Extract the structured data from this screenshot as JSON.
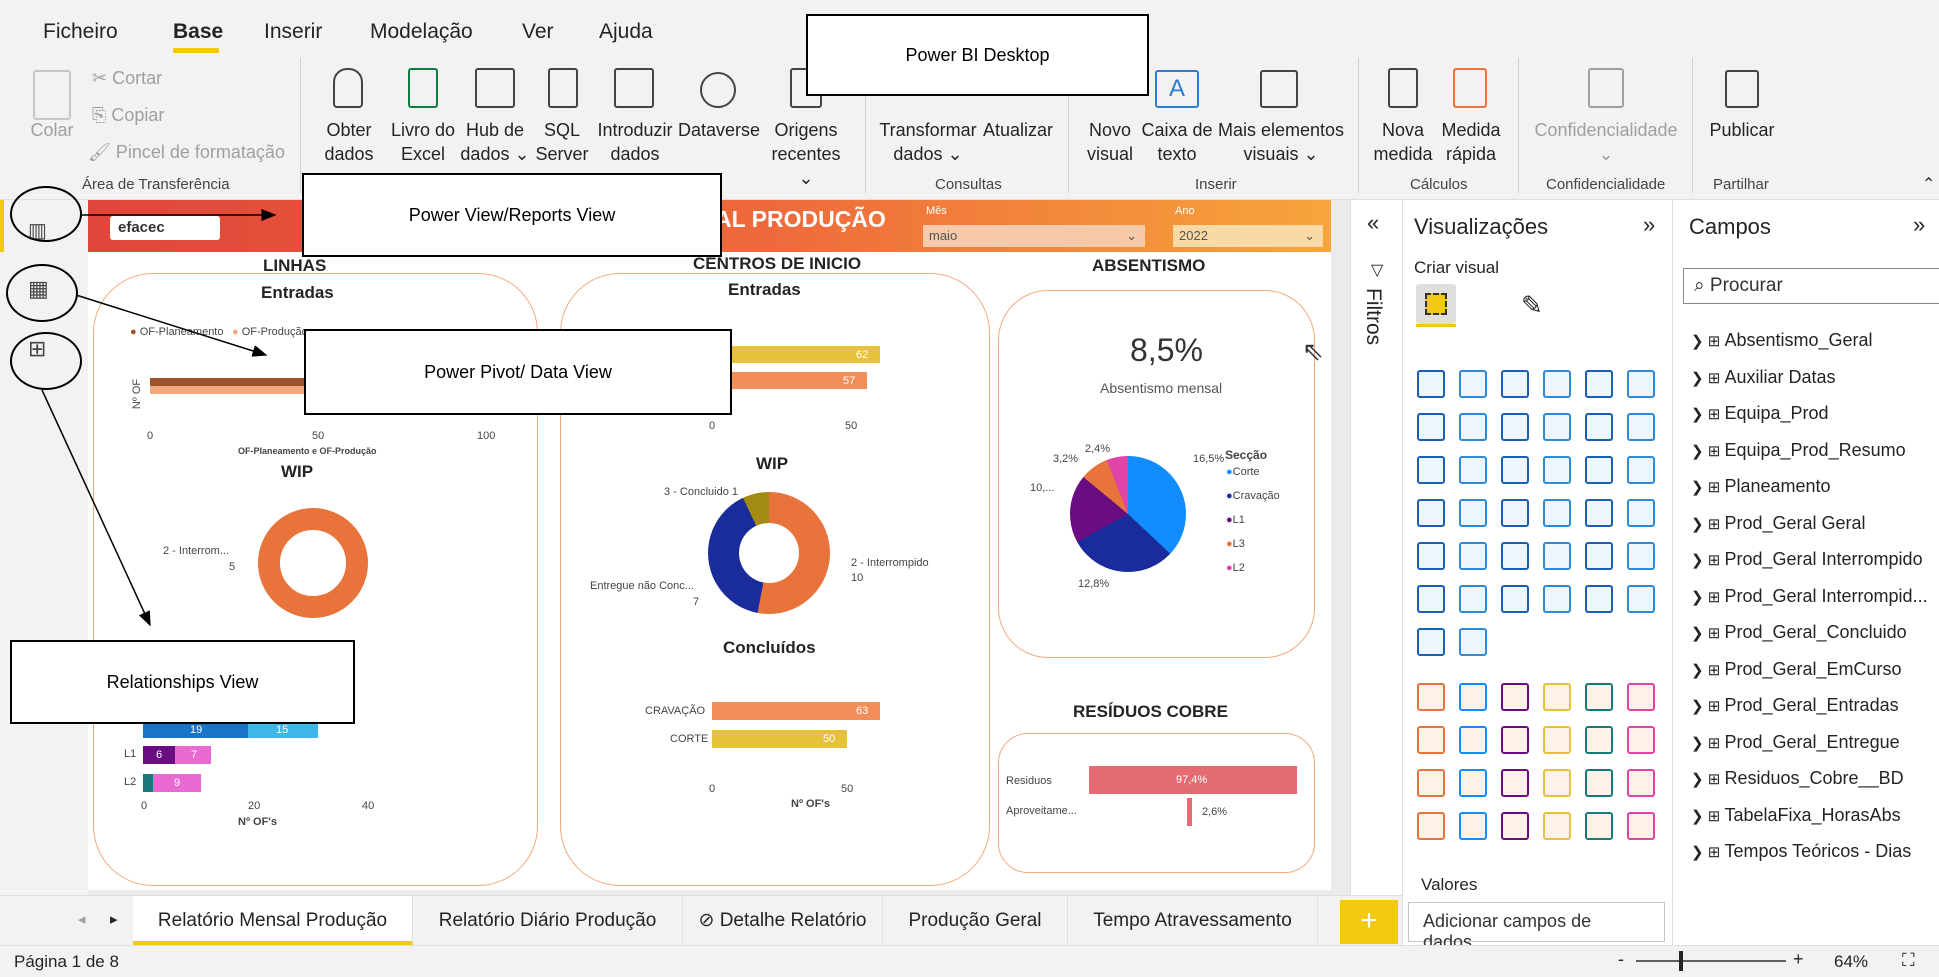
{
  "menu": {
    "file": "Ficheiro",
    "home": "Base",
    "insert": "Inserir",
    "modeling": "Modelação",
    "view": "Ver",
    "help": "Ajuda"
  },
  "ribbon": {
    "paste": "Colar",
    "cut": "Cortar",
    "copy": "Copiar",
    "format_painter": "Pincel de formatação",
    "clipboard_group": "Área de Transferência",
    "get_data_1": "Obter",
    "get_data_2": "dados",
    "excel_1": "Livro do",
    "excel_2": "Excel",
    "hub_1": "Hub de",
    "hub_2": "dados",
    "sql_1": "SQL",
    "sql_2": "Server",
    "enter_1": "Introduzir",
    "enter_2": "dados",
    "dataverse": "Dataverse",
    "recent_1": "Origens",
    "recent_2": "recentes",
    "transform_1": "Transformar",
    "transform_2": "dados",
    "refresh": "Atualizar",
    "queries_group": "Consultas",
    "new_visual_1": "Novo",
    "new_visual_2": "visual",
    "textbox_1": "Caixa de",
    "textbox_2": "texto",
    "more_visuals_1": "Mais elementos",
    "more_visuals_2": "visuais",
    "insert_group": "Inserir",
    "new_measure_1": "Nova",
    "new_measure_2": "medida",
    "quick_measure_1": "Medida",
    "quick_measure_2": "rápida",
    "calc_group": "Cálculos",
    "sensitivity": "Confidencialidade",
    "sensitivity_group": "Confidencialidade",
    "publish": "Publicar",
    "share_group": "Partilhar"
  },
  "callouts": {
    "desktop": "Power BI Desktop",
    "reports": "Power View/Reports View",
    "data": "Power Pivot/ Data View",
    "relationships": "Relationships View"
  },
  "report": {
    "header_title": "AL PRODUÇÃO",
    "logo": "efacec",
    "month_label": "Mês",
    "month_value": "maio",
    "year_label": "Ano",
    "year_value": "2022",
    "lines_title": "LINHAS",
    "entries_title": "Entradas",
    "legend_plan": "OF-Planeamento",
    "legend_prod": "OF-Produção",
    "of_axis": "Nº OF",
    "plan_prod_axis": "OF-Planeamento e OF-Produção",
    "x0": "0",
    "x50": "50",
    "x100": "100",
    "wip_title": "WIP",
    "wip_left_label": "2 - Interrom...",
    "wip_left_value": "5",
    "l1": "L1",
    "l2": "L2",
    "l1_v1": "6",
    "l1_v2": "7",
    "l2_v1": "9",
    "row_a_v1": "19",
    "row_a_v2": "15",
    "xs0": "0",
    "xs20": "20",
    "xs40": "40",
    "ofs_axis": "Nº OF's",
    "centros_title": "CENTROS DE INICIO",
    "centros_entries": "Entradas",
    "c_bar1": "62",
    "c_bar2": "57",
    "c_x0": "0",
    "c_x50": "50",
    "c_wip_title": "WIP",
    "c_wip_l1": "3 - Concluido 1",
    "c_wip_r1": "2 - Interrompido",
    "c_wip_r2": "10",
    "c_wip_l2": "Entregue não Conc...",
    "c_wip_l3": "7",
    "concl_title": "Concluídos",
    "cravacao": "CRAVAÇÃO",
    "cravacao_v": "63",
    "corte": "CORTE",
    "corte_v": "50",
    "concl_x0": "0",
    "concl_x50": "50",
    "concl_axis": "Nº OF's",
    "abs_title": "ABSENTISMO",
    "abs_value": "8,5%",
    "abs_label": "Absentismo mensal",
    "pie_24": "2,4%",
    "pie_32": "3,2%",
    "pie_165": "16,5%",
    "pie_10": "10,...",
    "pie_128": "12,8%",
    "seccao": "Secção",
    "leg_corte": "Corte",
    "leg_crav": "Cravação",
    "leg_l1": "L1",
    "leg_l3": "L3",
    "leg_l2": "L2",
    "res_title": "RESÍDUOS COBRE",
    "res_row1": "Residuos",
    "res_row1_v": "97,4%",
    "res_row2": "Aproveitame...",
    "res_row2_v": "2,6%"
  },
  "filters": {
    "label": "Filtros"
  },
  "visualizations": {
    "title": "Visualizações",
    "build": "Criar visual",
    "values": "Valores",
    "add_fields": "Adicionar campos de dados..."
  },
  "fields": {
    "title": "Campos",
    "search": "Procurar",
    "items": [
      "Absentismo_Geral",
      "Auxiliar Datas",
      "Equipa_Prod",
      "Equipa_Prod_Resumo",
      "Planeamento",
      "Prod_Geral Geral",
      "Prod_Geral Interrompido",
      "Prod_Geral Interrompid...",
      "Prod_Geral_Concluido",
      "Prod_Geral_EmCurso",
      "Prod_Geral_Entradas",
      "Prod_Geral_Entregue",
      "Residuos_Cobre__BD",
      "TabelaFixa_HorasAbs",
      "Tempos Teóricos - Dias"
    ]
  },
  "tabs": [
    "Relatório Mensal Produção",
    "Relatório Diário Produção",
    "Detalhe Relatório",
    "Produção Geral",
    "Tempo Atravessamento"
  ],
  "status": {
    "page": "Página 1 de 8",
    "zoom": "64%",
    "minus": "-",
    "plus": "+"
  },
  "colors": {
    "accent": "#f2c811",
    "orange": "#e8743b",
    "red_header": "#e0453b"
  }
}
